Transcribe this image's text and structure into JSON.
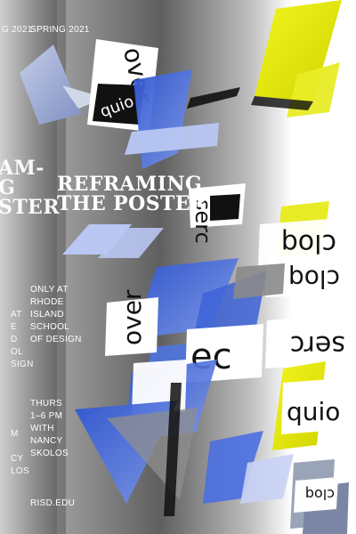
{
  "poster": {
    "season": "SPRING 2021",
    "season_echo": "G 2021",
    "title_lines": [
      "REFRAMING",
      "THE POSTER"
    ],
    "title_echo_lines": [
      "AM-",
      "G",
      "STER"
    ],
    "location_lines": [
      "ONLY AT",
      "RHODE",
      "ISLAND",
      "SCHOOL",
      "OF DESIGN"
    ],
    "location_echo_lines": [
      "AT",
      "E",
      "D",
      "OL",
      "SIGN"
    ],
    "time_lines": [
      "THURS",
      "1–6 PM",
      "WITH",
      "NANCY",
      "SKOLOS"
    ],
    "time_echo_lines": [
      "M",
      "",
      "CY",
      "LOS"
    ],
    "website": "RISD.EDU",
    "collage_words": [
      "over",
      "cloq",
      "quio",
      "serc"
    ],
    "colors": {
      "blue": "#3d63d8",
      "light_blue": "#b8c8f2",
      "yellow": "#e9ec21",
      "gray": "#8a8a8a",
      "black": "#111111",
      "white": "#ffffff"
    }
  }
}
